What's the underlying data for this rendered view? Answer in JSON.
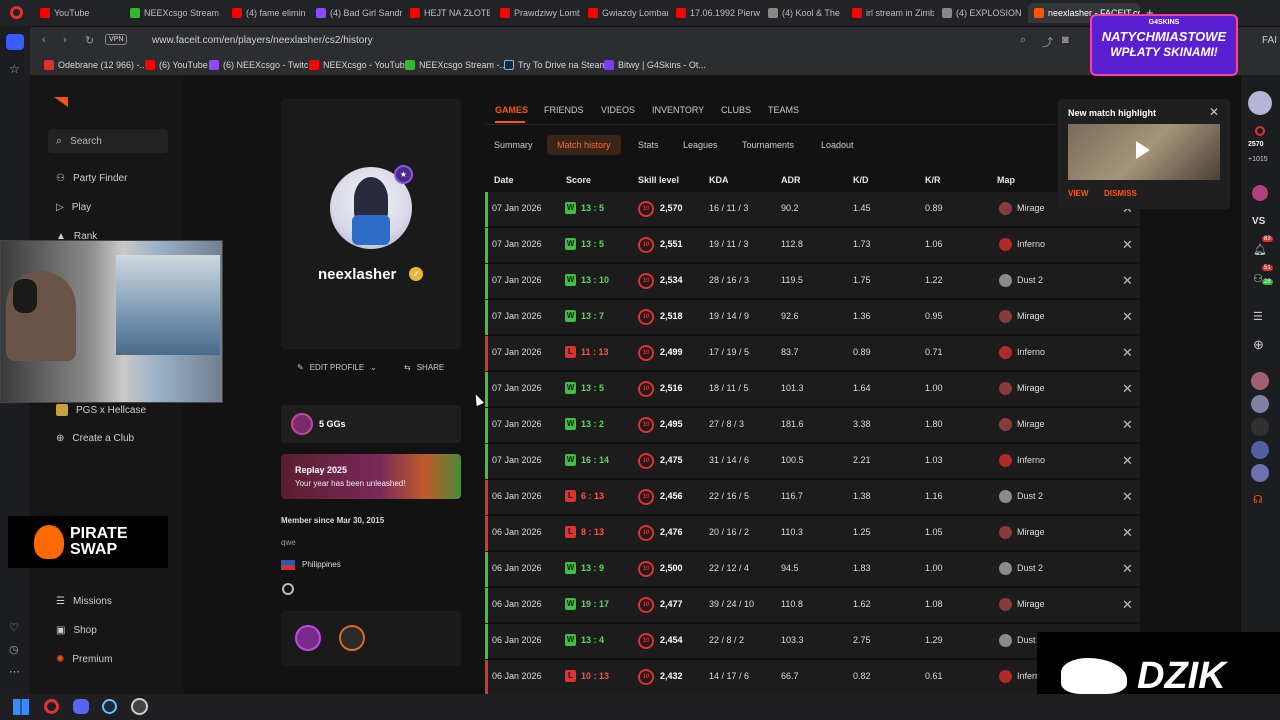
{
  "browser": {
    "tabs": [
      "YouTube",
      "NEEXcsgo Stream -",
      "(4) fame eliminato",
      "(4) Bad Girl Sandra",
      "HEJT NA ZŁOTE AN",
      "Prawdziwy Lombar",
      "Gwiazdy Lombardó",
      "17.06.1992 Pierwsz",
      "(4) Kool & The",
      "irl stream in Zimba",
      "(4) EXPLOSION",
      "neexlasher - FACEIT.com"
    ],
    "url": "www.faceit.com/en/players/neexlasher/cs2/history",
    "vpn": "VPN",
    "bookmarks": [
      "Odebrane (12 966) -...",
      "(6) YouTube",
      "(6) NEEXcsgo - Twitch",
      "NEEXcsgo - YouTube",
      "NEEXcsgo Stream -...",
      "Try To Drive na Steam",
      "Bitwy | G4Skins - Ot..."
    ],
    "ad_title": "NATYCHMIASTOWE",
    "ad_sub": "WPŁATY SKINAMI!",
    "ad_brand": "G4SKINS",
    "faceit_label": "FAI"
  },
  "sidebar": {
    "search": "Search",
    "items": [
      "Party Finder",
      "Play",
      "Rank"
    ],
    "club": "PGS x Hellcase",
    "create_club": "Create a Club",
    "bottom": [
      "Missions",
      "Shop",
      "Premium"
    ]
  },
  "overlay": {
    "brand1": "PIRATE",
    "brand2": "SWAP",
    "dzik": "DZIK"
  },
  "profile": {
    "name": "neexlasher",
    "edit": "EDIT PROFILE",
    "share": "SHARE",
    "ggs": "5 GGs",
    "replay_title": "Replay 2025",
    "replay_sub": "Your year has been unleashed!",
    "member_since": "Member since Mar 30, 2015",
    "bio": "qwe",
    "country": "Philippines"
  },
  "tabs": [
    "GAMES",
    "FRIENDS",
    "VIDEOS",
    "INVENTORY",
    "CLUBS",
    "TEAMS"
  ],
  "subtabs": [
    "Summary",
    "Match history",
    "Stats",
    "Leagues",
    "Tournaments",
    "Loadout"
  ],
  "columns": [
    "Date",
    "Score",
    "Skill level",
    "KDA",
    "ADR",
    "K/D",
    "K/R",
    "Map"
  ],
  "matches": [
    {
      "date": "07 Jan 2026",
      "res": "W",
      "score": "13 : 5",
      "elo": "2,570",
      "kda": "16 / 11 / 3",
      "adr": "90.2",
      "kd": "1.45",
      "kr": "0.89",
      "map": "Mirage"
    },
    {
      "date": "07 Jan 2026",
      "res": "W",
      "score": "13 : 5",
      "elo": "2,551",
      "kda": "19 / 11 / 3",
      "adr": "112.8",
      "kd": "1.73",
      "kr": "1.06",
      "map": "Inferno"
    },
    {
      "date": "07 Jan 2026",
      "res": "W",
      "score": "13 : 10",
      "elo": "2,534",
      "kda": "28 / 16 / 3",
      "adr": "119.5",
      "kd": "1.75",
      "kr": "1.22",
      "map": "Dust 2"
    },
    {
      "date": "07 Jan 2026",
      "res": "W",
      "score": "13 : 7",
      "elo": "2,518",
      "kda": "19 / 14 / 9",
      "adr": "92.6",
      "kd": "1.36",
      "kr": "0.95",
      "map": "Mirage"
    },
    {
      "date": "07 Jan 2026",
      "res": "L",
      "score": "11 : 13",
      "elo": "2,499",
      "kda": "17 / 19 / 5",
      "adr": "83.7",
      "kd": "0.89",
      "kr": "0.71",
      "map": "Inferno"
    },
    {
      "date": "07 Jan 2026",
      "res": "W",
      "score": "13 : 5",
      "elo": "2,516",
      "kda": "18 / 11 / 5",
      "adr": "101.3",
      "kd": "1.64",
      "kr": "1.00",
      "map": "Mirage"
    },
    {
      "date": "07 Jan 2026",
      "res": "W",
      "score": "13 : 2",
      "elo": "2,495",
      "kda": "27 / 8 / 3",
      "adr": "181.6",
      "kd": "3.38",
      "kr": "1.80",
      "map": "Mirage"
    },
    {
      "date": "07 Jan 2026",
      "res": "W",
      "score": "16 : 14",
      "elo": "2,475",
      "kda": "31 / 14 / 6",
      "adr": "100.5",
      "kd": "2.21",
      "kr": "1.03",
      "map": "Inferno"
    },
    {
      "date": "06 Jan 2026",
      "res": "L",
      "score": "6 : 13",
      "elo": "2,456",
      "kda": "22 / 16 / 5",
      "adr": "116.7",
      "kd": "1.38",
      "kr": "1.16",
      "map": "Dust 2"
    },
    {
      "date": "06 Jan 2026",
      "res": "L",
      "score": "8 : 13",
      "elo": "2,476",
      "kda": "20 / 16 / 2",
      "adr": "110.3",
      "kd": "1.25",
      "kr": "1.05",
      "map": "Mirage"
    },
    {
      "date": "06 Jan 2026",
      "res": "W",
      "score": "13 : 9",
      "elo": "2,500",
      "kda": "22 / 12 / 4",
      "adr": "94.5",
      "kd": "1.83",
      "kr": "1.00",
      "map": "Dust 2"
    },
    {
      "date": "06 Jan 2026",
      "res": "W",
      "score": "19 : 17",
      "elo": "2,477",
      "kda": "39 / 24 / 10",
      "adr": "110.8",
      "kd": "1.62",
      "kr": "1.08",
      "map": "Mirage"
    },
    {
      "date": "06 Jan 2026",
      "res": "W",
      "score": "13 : 4",
      "elo": "2,454",
      "kda": "22 / 8 / 2",
      "adr": "103.3",
      "kd": "2.75",
      "kr": "1.29",
      "map": "Dust"
    },
    {
      "date": "06 Jan 2026",
      "res": "L",
      "score": "10 : 13",
      "elo": "2,432",
      "kda": "14 / 17 / 6",
      "adr": "66.7",
      "kd": "0.82",
      "kr": "0.61",
      "map": "Infern"
    }
  ],
  "highlight": {
    "title": "New match highlight",
    "view": "VIEW",
    "dismiss": "DISMISS"
  },
  "right_stats": {
    "elo": "2570",
    "gain": "+1015",
    "vs": "VS",
    "n1": "83",
    "n2": "51",
    "n3": "28"
  },
  "colors": {
    "accent": "#ff5500",
    "win": "#3ec33e",
    "loss": "#e0322e",
    "bg": "#121212"
  }
}
